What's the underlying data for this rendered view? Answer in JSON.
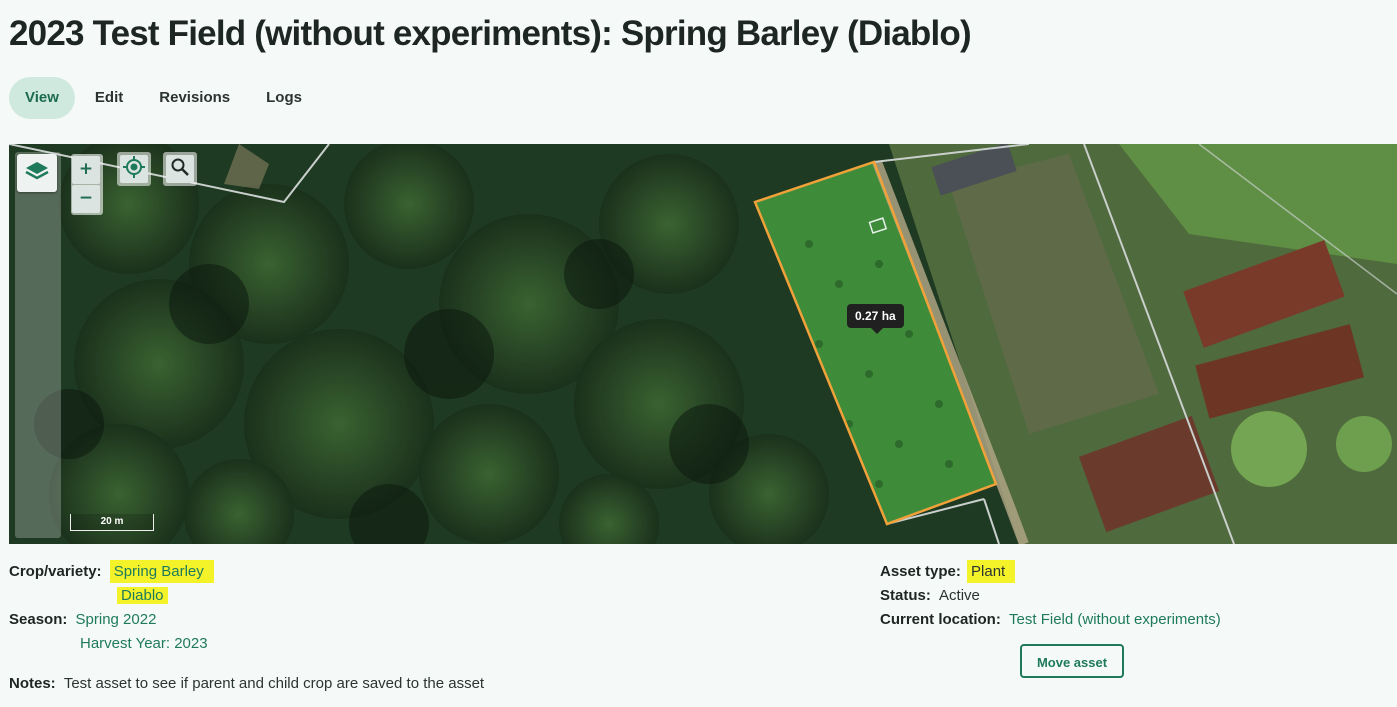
{
  "page": {
    "title": "2023 Test Field (without experiments): Spring Barley (Diablo)"
  },
  "tabs": [
    {
      "label": "View",
      "active": true
    },
    {
      "label": "Edit",
      "active": false
    },
    {
      "label": "Revisions",
      "active": false
    },
    {
      "label": "Logs",
      "active": false
    }
  ],
  "map": {
    "zoom_in": "+",
    "zoom_out": "−",
    "scale_label": "20 m",
    "area_label": "0.27 ha",
    "outline_color": "#f0a13a",
    "icons": [
      "layers-icon",
      "geolocate-icon",
      "search-icon"
    ]
  },
  "details": {
    "crop_label": "Crop/variety:",
    "crop_values": [
      "Spring Barley",
      "Diablo"
    ],
    "season_label": "Season:",
    "season_values": [
      "Spring 2022",
      "Harvest Year: 2023"
    ],
    "notes_label": "Notes:",
    "notes_value": "Test asset to see if parent and child crop are saved to the asset",
    "asset_type_label": "Asset type:",
    "asset_type_value": "Plant",
    "status_label": "Status:",
    "status_value": "Active",
    "location_label": "Current location:",
    "location_value": "Test Field (without experiments)",
    "move_button": "Move asset"
  },
  "colors": {
    "accent": "#1f7a5c",
    "highlight": "#f4f32a",
    "active_tab_bg": "#cfe9df"
  }
}
